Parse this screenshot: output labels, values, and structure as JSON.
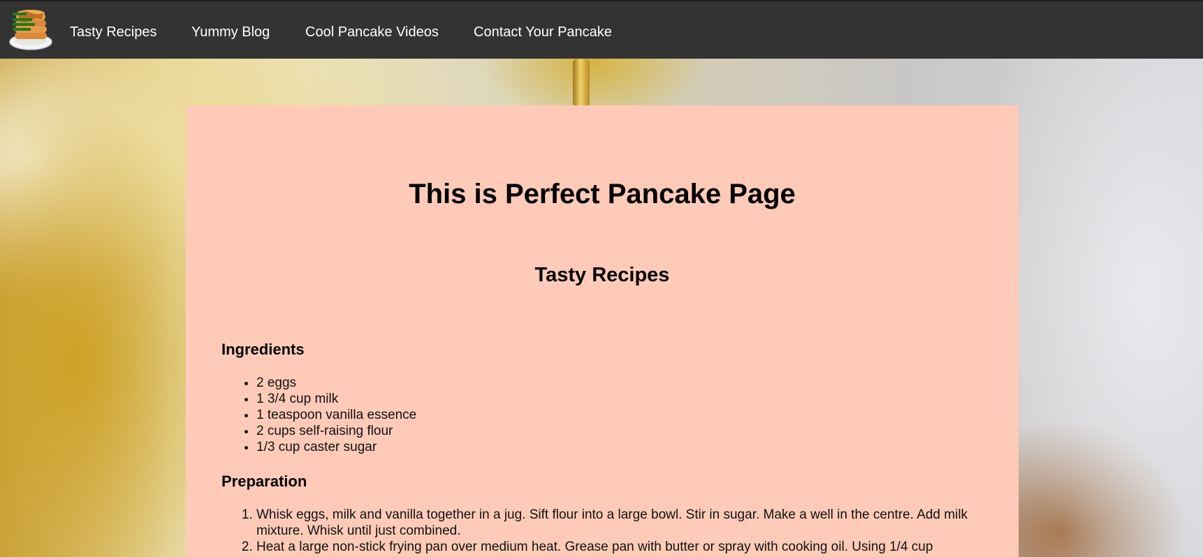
{
  "nav": {
    "logo_alt": "pancake-stack-logo",
    "links": [
      {
        "label": "Tasty Recipes"
      },
      {
        "label": "Yummy Blog"
      },
      {
        "label": "Cool Pancake Videos"
      },
      {
        "label": "Contact Your Pancake"
      }
    ]
  },
  "main": {
    "page_title": "This is Perfect Pancake Page",
    "section_title": "Tasty Recipes",
    "ingredients": {
      "heading": "Ingredients",
      "items": [
        "2 eggs",
        "1 3/4 cup milk",
        "1 teaspoon vanilla essence",
        "2 cups self-raising flour",
        "1/3 cup caster sugar"
      ]
    },
    "preparation": {
      "heading": "Preparation",
      "steps": [
        "Whisk eggs, milk and vanilla together in a jug. Sift flour into a large bowl. Stir in sugar. Make a well in the centre. Add milk mixture. Whisk until just combined.",
        "Heat a large non-stick frying pan over medium heat. Grease pan with butter or spray with cooking oil. Using 1/4 cup"
      ]
    }
  },
  "colors": {
    "navbar_bg": "#333333",
    "nav_text": "#ffffff",
    "card_bg": "#ffcbb8",
    "heading_text": "#000000"
  }
}
